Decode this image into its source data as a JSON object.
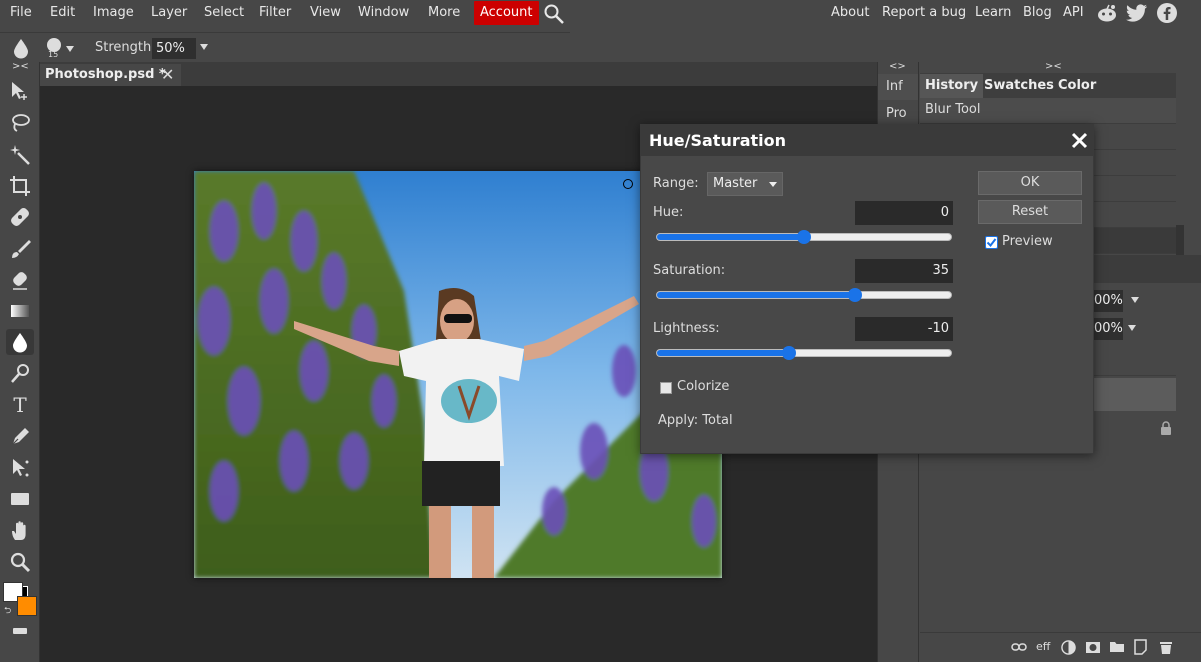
{
  "menu": {
    "items": [
      "File",
      "Edit",
      "Image",
      "Layer",
      "Select",
      "Filter",
      "View",
      "Window",
      "More"
    ],
    "account": "Account",
    "right_links": [
      "About",
      "Report a bug",
      "Learn",
      "Blog",
      "API"
    ]
  },
  "options_bar": {
    "brush_size": "15",
    "strength_label": "Strength:",
    "strength_value": "50%"
  },
  "document": {
    "tab_title": "Photoshop.psd *"
  },
  "mini_panel": {
    "collapse": "<>",
    "items": [
      "Inf",
      "Pro"
    ]
  },
  "right_panel": {
    "collapse": "><",
    "tabs": [
      "History",
      "Swatches",
      "Color"
    ],
    "history_items": [
      "Blur Tool"
    ],
    "opacity_1": "00%",
    "opacity_2": "00%",
    "footer_eff": "eff"
  },
  "toolbar": {
    "collapse": "><"
  },
  "dialog": {
    "title": "Hue/Saturation",
    "range_label": "Range:",
    "range_value": "Master",
    "hue_label": "Hue:",
    "hue_value": "0",
    "hue_fraction": 0.5,
    "saturation_label": "Saturation:",
    "saturation_value": "35",
    "saturation_fraction": 0.675,
    "lightness_label": "Lightness:",
    "lightness_value": "-10",
    "lightness_fraction": 0.45,
    "ok": "OK",
    "reset": "Reset",
    "preview_label": "Preview",
    "preview_checked": true,
    "colorize_label": "Colorize",
    "colorize_checked": false,
    "apply_text": "Apply: Total"
  },
  "colors": {
    "account": "#cc0000",
    "accent": "#1a73e8",
    "foreground": "#ffffff",
    "background": "#ff8c00"
  }
}
